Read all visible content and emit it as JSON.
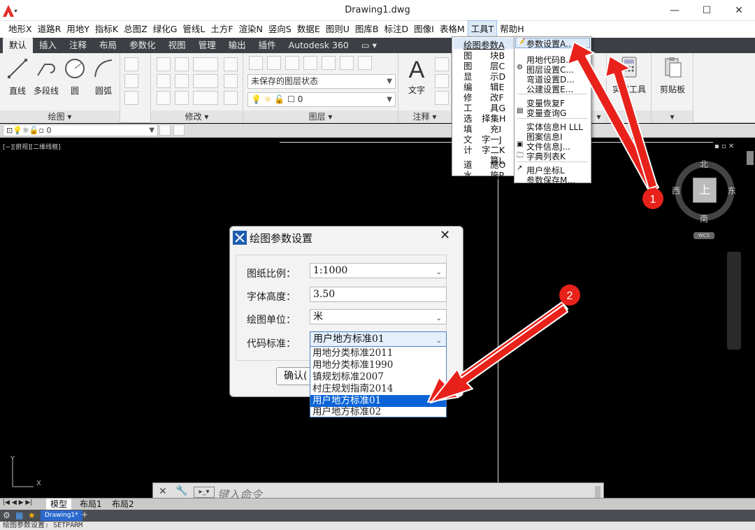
{
  "window": {
    "title": "Drawing1.dwg"
  },
  "menubar": [
    "地形X",
    "道路R",
    "用地Y",
    "指标K",
    "总图Z",
    "绿化G",
    "管线L",
    "土方F",
    "渲染N",
    "竖向S",
    "数据E",
    "图则U",
    "图库B",
    "标注D",
    "图像I",
    "表格M",
    "工具T",
    "帮助H"
  ],
  "ribbon_tabs": [
    "默认",
    "插入",
    "注释",
    "布局",
    "参数化",
    "视图",
    "管理",
    "输出",
    "插件",
    "Autodesk 360",
    "▭ ▾"
  ],
  "ribbon": {
    "draw_tools": [
      "直线",
      "多段线",
      "圆",
      "圆弧"
    ],
    "draw_panel": "绘图 ▾",
    "modify_panel": "修改 ▾",
    "layer_state": "未保存的图层状态",
    "layer_value": "0",
    "layer_panel": "图层 ▾",
    "text_tool": "文字",
    "annot_panel": "注释 ▾",
    "util_tool": "实用工具",
    "clipboard_tool": "剪贴板"
  },
  "quickbar": {
    "layer": "0"
  },
  "viewport_label": "[−][俯视][二维线框]",
  "navcube": {
    "north": "北",
    "south": "南",
    "east": "东",
    "west": "西",
    "top": "上",
    "wcs": "WCS"
  },
  "ucs": {
    "y": "Y",
    "x": "X"
  },
  "tools_menu": {
    "col1": [
      "绘图参数A",
      "图",
      "图",
      "显",
      "编",
      "修",
      "工",
      "选",
      "填",
      "文",
      "计",
      "道",
      "水"
    ],
    "col2": [
      "块B",
      "层C",
      "示D",
      "辑E",
      "改F",
      "具G",
      "择集H",
      "充I",
      "字一J",
      "字二K",
      "算L",
      "施O",
      "施P"
    ]
  },
  "submenu": [
    "参数设置A...",
    "用地代码B...",
    "图层设置C...",
    "弯道设置D...",
    "公建设置E...",
    "变量恢复F",
    "变量查询G",
    "实体信息H LLL",
    "图案信息I",
    "文件信息J...",
    "字典列表K",
    "用户坐标L",
    "参数保存M..."
  ],
  "dialog": {
    "title": "绘图参数设置",
    "scale_label": "图纸比例：",
    "scale_value": "1:1000",
    "font_label": "字体高度：",
    "font_value": "3.50",
    "unit_label": "绘图单位：",
    "unit_value": "米",
    "code_label": "代码标准：",
    "code_value": "用户地方标准01",
    "ok_label": "确认(",
    "code_options": [
      "用地分类标准2011",
      "用地分类标准1990",
      "镇规划标准2007",
      "村庄规划指南2014",
      "用户地方标准01",
      "用户地方标准02"
    ]
  },
  "cmdline": {
    "placeholder": "键入命令"
  },
  "layout_tabs": [
    "模型",
    "布局1",
    "布局2"
  ],
  "status_tab": "Drawing1*",
  "command_status": "绘图参数设置: SETPARM",
  "callouts": [
    "1",
    "2"
  ],
  "colors": {
    "accent": "#0a64d8",
    "arrow": "#e8221b",
    "ribbon_dark": "#3c3f44"
  }
}
